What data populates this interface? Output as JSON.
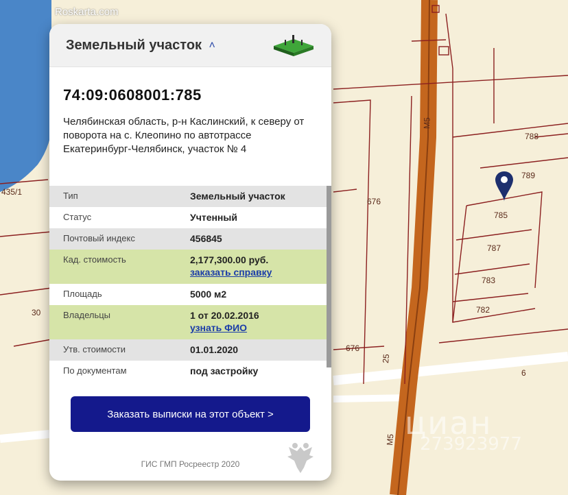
{
  "site": {
    "name": "Roskarta.com"
  },
  "watermark": {
    "brand": "циан",
    "id": "273923977"
  },
  "map": {
    "road_labels": [
      "M5",
      "M5",
      "25",
      "6"
    ],
    "parcel_labels": [
      "788",
      "789",
      "785",
      "787",
      "783",
      "782",
      "676",
      "676",
      "435/1",
      "30"
    ],
    "marker_icon": "location-pin-icon"
  },
  "card": {
    "title": "Земельный участок",
    "collapse_icon": "chevron-up-icon",
    "plot_icon": "land-plot-icon",
    "cadastral_number": "74:09:0608001:785",
    "address": "Челябинская область, р-н Каслинский, к северу от поворота на с. Клеопино по автотрассе Екатеринбург-Челябинск, участок № 4",
    "rows": [
      {
        "label": "Тип",
        "value": "Земельный участок"
      },
      {
        "label": "Статус",
        "value": "Учтенный"
      },
      {
        "label": "Почтовый индекс",
        "value": "456845"
      },
      {
        "label": "Кад. стоимость",
        "value": "2,177,300.00 руб.",
        "link": "заказать справку"
      },
      {
        "label": "Площадь",
        "value": "5000 м2"
      },
      {
        "label": "Владельцы",
        "value": "1 от 20.02.2016",
        "link": "узнать ФИО"
      },
      {
        "label": "Утв. стоимости",
        "value": "01.01.2020"
      },
      {
        "label": "По документам",
        "value": "под застройку"
      }
    ],
    "order_button": "Заказать выписки на этот объект >",
    "footer": "ГИС ГМП Росреестр 2020",
    "emblem_icon": "double-headed-eagle-icon"
  },
  "colors": {
    "road": "#a65a1e",
    "parcel_line": "#8b1f1f",
    "water": "#4a86c8",
    "button": "#14198c",
    "highlight_row": "#d6e4a8"
  }
}
